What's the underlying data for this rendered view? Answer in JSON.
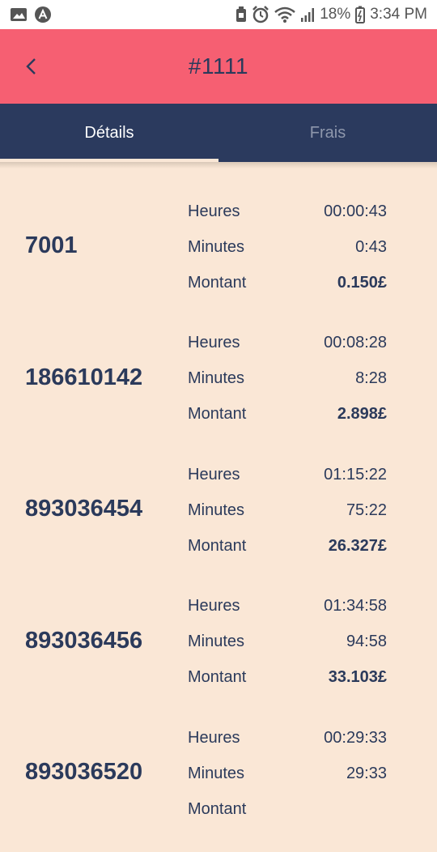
{
  "status_bar": {
    "battery": "18%",
    "time": "3:34 PM",
    "icons": [
      "image-icon",
      "app-icon",
      "battery-saver-icon",
      "alarm-icon",
      "wifi-icon",
      "signal-icon",
      "battery-icon"
    ]
  },
  "app_bar": {
    "title": "#1111",
    "back_icon": "chevron-left-icon"
  },
  "tabs": [
    {
      "label": "Détails",
      "active": true
    },
    {
      "label": "Frais",
      "active": false
    }
  ],
  "records": [
    {
      "id": "7001",
      "hours_label": "Heures",
      "hours": "00:00:43",
      "minutes_label": "Minutes",
      "minutes": "0:43",
      "amount_label": "Montant",
      "amount": "0.150£"
    },
    {
      "id": "186610142",
      "hours_label": "Heures",
      "hours": "00:08:28",
      "minutes_label": "Minutes",
      "minutes": "8:28",
      "amount_label": "Montant",
      "amount": "2.898£"
    },
    {
      "id": "893036454",
      "hours_label": "Heures",
      "hours": "01:15:22",
      "minutes_label": "Minutes",
      "minutes": "75:22",
      "amount_label": "Montant",
      "amount": "26.327£"
    },
    {
      "id": "893036456",
      "hours_label": "Heures",
      "hours": "01:34:58",
      "minutes_label": "Minutes",
      "minutes": "94:58",
      "amount_label": "Montant",
      "amount": "33.103£"
    },
    {
      "id": "893036520",
      "hours_label": "Heures",
      "hours": "00:29:33",
      "minutes_label": "Minutes",
      "minutes": "29:33",
      "amount_label": "Montant",
      "amount": ""
    }
  ],
  "colors": {
    "app_bar": "#F65F72",
    "tab_bar": "#2B3A5E",
    "background": "#FAE7D6",
    "text": "#2B3A5B"
  }
}
